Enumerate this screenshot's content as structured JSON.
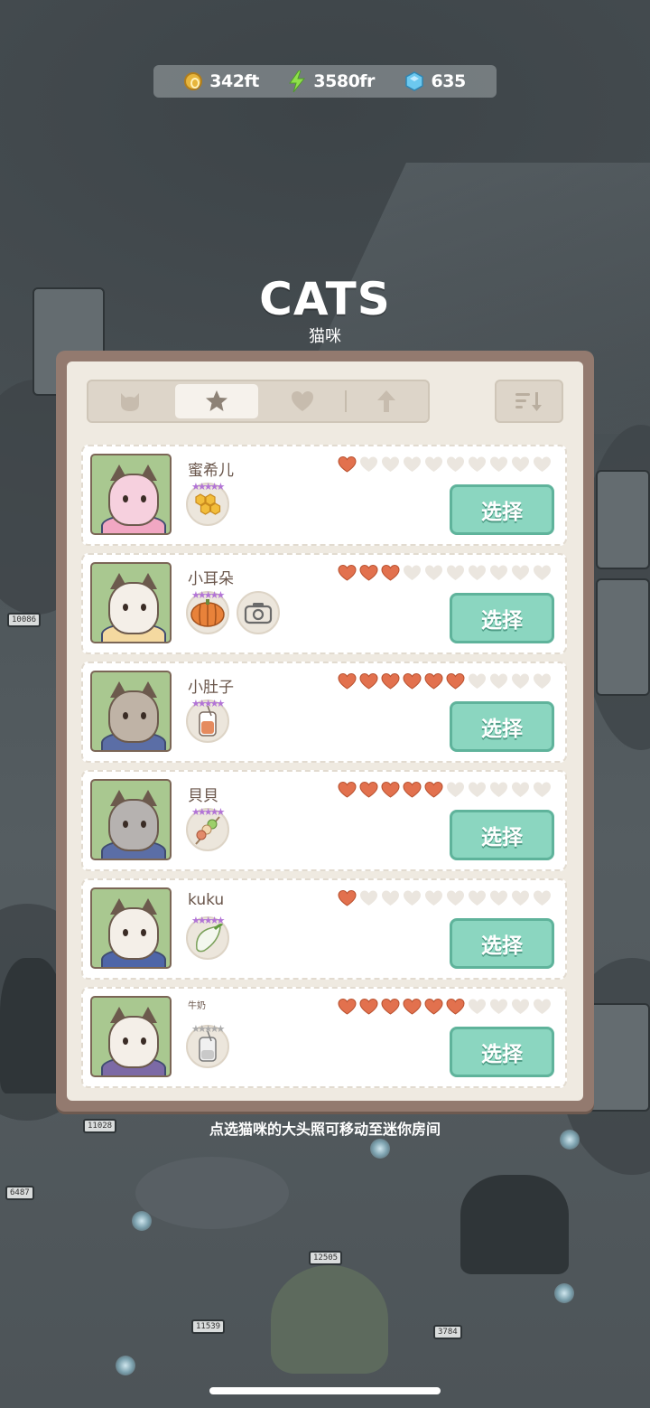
{
  "currency": {
    "coins": "342ft",
    "energy": "3580fr",
    "gems": "635"
  },
  "header": {
    "title": "CATS",
    "subtitle": "猫咪"
  },
  "tabs": [
    {
      "icon": "cat-face-icon",
      "active": false
    },
    {
      "icon": "star-icon",
      "active": true
    },
    {
      "icon": "heart-icon",
      "active": false
    },
    {
      "icon": "arrow-up-icon",
      "active": false
    }
  ],
  "sort": {
    "icon": "sort-descending-icon"
  },
  "select_label": "选择",
  "cats": [
    {
      "name": "蜜希儿",
      "hearts": 1,
      "max_hearts": 10,
      "badges": [
        "honeycomb-icon"
      ],
      "badge_star_color": "#b274d6",
      "portrait_bg": "#a9c890"
    },
    {
      "name": "小耳朵",
      "hearts": 3,
      "max_hearts": 10,
      "badges": [
        "pumpkin-icon",
        "camera-icon"
      ],
      "badge_star_color": "#b274d6",
      "portrait_bg": "#a9c890"
    },
    {
      "name": "小肚子",
      "hearts": 6,
      "max_hearts": 10,
      "badges": [
        "juice-bottle-icon"
      ],
      "badge_star_color": "#b274d6",
      "portrait_bg": "#a9c890"
    },
    {
      "name": "貝貝",
      "hearts": 5,
      "max_hearts": 10,
      "badges": [
        "skewer-icon"
      ],
      "badge_star_color": "#b274d6",
      "portrait_bg": "#a9c890"
    },
    {
      "name": "kuku",
      "hearts": 1,
      "max_hearts": 10,
      "badges": [
        "radish-icon"
      ],
      "badge_star_color": "#b274d6",
      "portrait_bg": "#a9c890"
    },
    {
      "name": "牛奶",
      "hearts": 6,
      "max_hearts": 10,
      "badges": [
        "empty-bottle-icon"
      ],
      "badge_star_color": "#aaaaaa",
      "portrait_bg": "#a9c890"
    }
  ],
  "hint": "点选猫咪的大头照可移动至迷你房间",
  "colors": {
    "heart_filled": "#e2714e",
    "heart_empty": "#ebe6df",
    "select_button": "#8bd6c0",
    "panel_frame": "#937a6f"
  }
}
